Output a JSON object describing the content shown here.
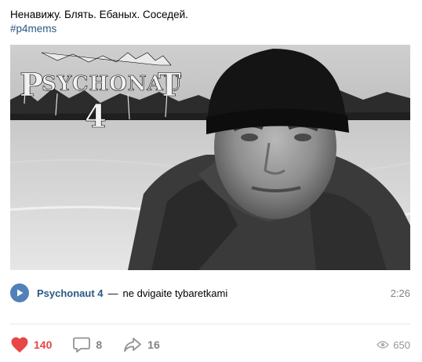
{
  "post": {
    "text": "Ненавижу. Блять. Ебаных. Соседей.",
    "hashtag": "#p4mems"
  },
  "media": {
    "overlay_logo_text": "Psychonaut 4",
    "description": ""
  },
  "audio": {
    "artist": "Psychonaut 4",
    "separator": "—",
    "title": "ne dvigaite tybaretkami",
    "duration": "2:26"
  },
  "actions": {
    "likes": "140",
    "comments": "8",
    "shares": "16",
    "views": "650"
  },
  "colors": {
    "link": "#2a5885",
    "play_button": "#5181b8",
    "like": "#e64646",
    "muted": "#828282"
  },
  "icons": {
    "play": "play-icon",
    "like": "heart-icon",
    "comment": "comment-icon",
    "share": "share-arrow-icon",
    "views": "eye-icon"
  }
}
